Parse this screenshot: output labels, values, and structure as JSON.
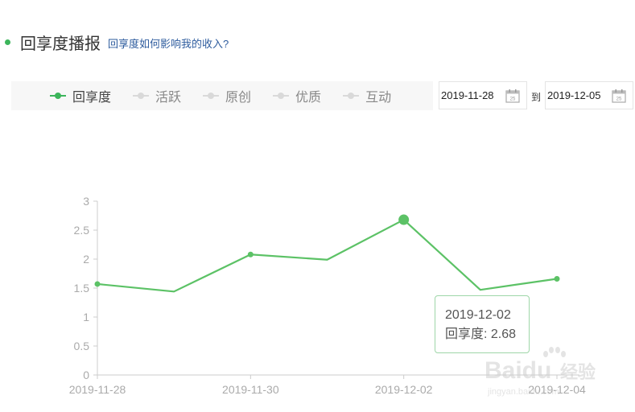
{
  "header": {
    "title": "回享度播报",
    "help_link": "回享度如何影响我的收入?"
  },
  "legend": [
    {
      "label": "回享度",
      "active": true
    },
    {
      "label": "活跃",
      "active": false
    },
    {
      "label": "原创",
      "active": false
    },
    {
      "label": "优质",
      "active": false
    },
    {
      "label": "互动",
      "active": false
    }
  ],
  "date_range": {
    "start": "2019-11-28",
    "separator": "到",
    "end": "2019-12-05"
  },
  "tooltip": {
    "date": "2019-12-02",
    "label": "回享度: 2.68"
  },
  "watermark": {
    "brand": "Baidu",
    "cn": "经验",
    "url": "jingyan.baidu.com"
  },
  "colors": {
    "accent": "#3cb55b",
    "line": "#5cc266",
    "axis": "#cccccc",
    "tick_text": "#aaaaaa"
  },
  "chart_data": {
    "type": "line",
    "x": [
      "2019-11-28",
      "2019-11-29",
      "2019-11-30",
      "2019-12-01",
      "2019-12-02",
      "2019-12-03",
      "2019-12-04"
    ],
    "xtick_labels": [
      "2019-11-28",
      "2019-11-30",
      "2019-12-02",
      "2019-12-04"
    ],
    "series": [
      {
        "name": "回享度",
        "values": [
          1.57,
          1.44,
          2.08,
          1.99,
          2.68,
          1.47,
          1.66
        ],
        "marked": [
          true,
          false,
          true,
          false,
          true,
          false,
          true
        ]
      }
    ],
    "highlight_index": 4,
    "ylim": [
      0,
      3
    ],
    "yticks": [
      "0",
      "0.5",
      "1",
      "1.5",
      "2",
      "2.5",
      "3"
    ],
    "grid": false
  }
}
